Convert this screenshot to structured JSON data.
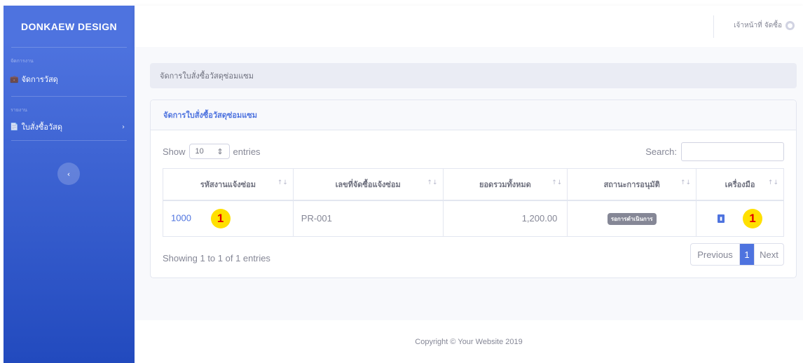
{
  "sidebar": {
    "brand": "DONKAEW DESIGN",
    "sections": [
      {
        "heading": "จัดการงาน",
        "item": {
          "label": "จัดการวัสดุ",
          "icon": "briefcase-icon"
        }
      },
      {
        "heading": "รายงาน",
        "item": {
          "label": "ใบสั่งซื้อวัสดุ",
          "icon": "file-icon",
          "chevron": "›"
        }
      }
    ],
    "toggle_glyph": "‹"
  },
  "topbar": {
    "user_label": "เจ้าหน้าที่ จัดซื้อ",
    "user_icon": "user-circle-icon"
  },
  "breadcrumb": "จัดการใบสั่งซื้อวัสดุซ่อมแซม",
  "card": {
    "title": "จัดการใบสั่งซื้อวัสดุซ่อมแซม",
    "show_label": "Show",
    "page_size": "10",
    "entries_label": "entries",
    "search_label": "Search:",
    "columns": [
      "รหัสงานแจ้งซ่อม",
      "เลขที่จัดซื้อแจ้งซ่อม",
      "ยอดรวมทั้งหมด",
      "สถานะการอนุมัติ",
      "เครื่องมือ"
    ],
    "sort_glyph": "↑↓",
    "rows": [
      {
        "id": "1000",
        "po": "PR-001",
        "total": "1,200.00",
        "status": "รอการดำเนินการ",
        "tool_icon": "pdf-icon"
      }
    ],
    "markers": [
      "1",
      "1"
    ],
    "info": "Showing 1 to 1 of 1 entries",
    "pager": {
      "prev": "Previous",
      "current": "1",
      "next": "Next"
    }
  },
  "footer": "Copyright © Your Website 2019",
  "colors": {
    "primary": "#4e73df",
    "sidebar_dark": "#224abe",
    "marker": "#ffe000",
    "marker_text": "#e30000"
  }
}
